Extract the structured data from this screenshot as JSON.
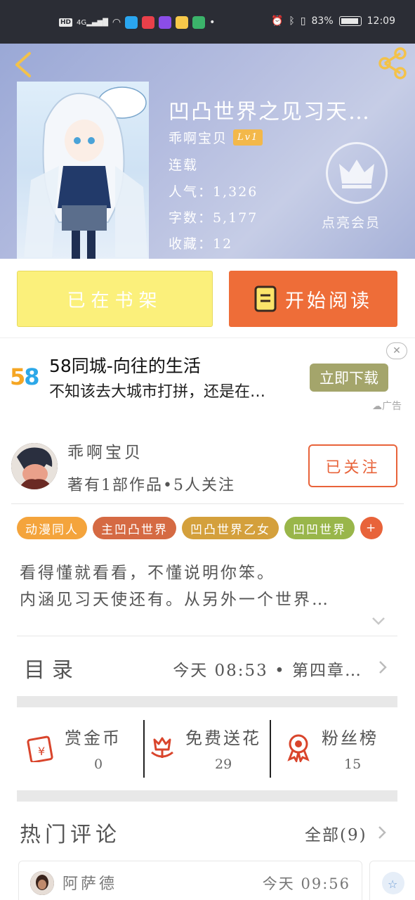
{
  "status_bar": {
    "hd": "HD",
    "signal": "4G",
    "battery_pct": "83%",
    "time": "12:09"
  },
  "book": {
    "title": "凹凸世界之见习天…",
    "author": "乖啊宝贝",
    "level": "Lv1",
    "status": "连载",
    "popularity": "人气：1,326",
    "word_count": "字数：5,177",
    "favorites": "收藏：12",
    "vip_label": "点亮会员"
  },
  "actions": {
    "shelf_label": "已在书架",
    "read_label": "开始阅读"
  },
  "ad": {
    "logo": "58",
    "title": "58同城-向往的生活",
    "desc": "不知该去大城市打拼，还是在…",
    "button": "立即下载",
    "tag": "广告"
  },
  "author_card": {
    "name": "乖啊宝贝",
    "stats": "著有1部作品•5人关注",
    "follow_label": "已关注"
  },
  "tags": [
    {
      "label": "动漫同人",
      "color": "#f4a43c"
    },
    {
      "label": "主凹凸世界",
      "color": "#d56a43"
    },
    {
      "label": "凹凸世界乙女",
      "color": "#d4a03c"
    },
    {
      "label": "凹凹世界",
      "color": "#99b64a"
    },
    {
      "label": "+",
      "color": "#e8633a"
    }
  ],
  "description": {
    "line1": "看得懂就看看，不懂说明你笨。",
    "line2": "内涵见习天使还有。从另外一个世界…"
  },
  "toc": {
    "title": "目录",
    "latest": "今天 08:53 • 第四章…"
  },
  "stats": {
    "reward_label": "赏金币",
    "reward_value": "0",
    "flower_label": "免费送花",
    "flower_value": "29",
    "fans_label": "粉丝榜",
    "fans_value": "15"
  },
  "comments": {
    "title": "热门评论",
    "all_label": "全部(9)",
    "first": {
      "name": "阿萨德",
      "time": "今天 09:56"
    }
  },
  "colors": {
    "accent": "#ee6d38",
    "shelf_yellow": "#fbf07b",
    "ad_button": "#a4a56b",
    "icon_red": "#d9452c"
  }
}
